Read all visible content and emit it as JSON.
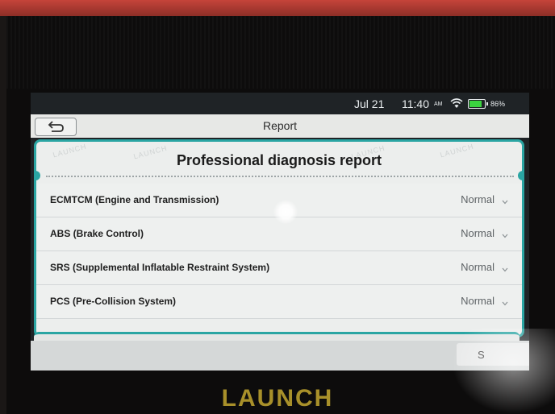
{
  "status_bar": {
    "date": "Jul 21",
    "time": "11:40",
    "ampm": "AM",
    "battery_percent": "86%",
    "battery_level": 0.86,
    "icons": [
      "wifi-icon",
      "battery-icon"
    ]
  },
  "title_bar": {
    "title": "Report",
    "back_icon": "back-arrow-icon"
  },
  "report": {
    "heading": "Professional diagnosis report",
    "watermark": "LAUNCH",
    "systems": [
      {
        "name": "ECMTCM (Engine and Transmission)",
        "status": "Normal"
      },
      {
        "name": "ABS (Brake Control)",
        "status": "Normal"
      },
      {
        "name": "SRS (Supplemental Inflatable Restraint System)",
        "status": "Normal"
      },
      {
        "name": "PCS (Pre-Collision System)",
        "status": "Normal"
      }
    ]
  },
  "toolbar": {
    "save_label": "S"
  },
  "device": {
    "brand": "LAUNCH"
  },
  "colors": {
    "accent": "#2aa5a3",
    "battery": "#3bd43f",
    "brand": "#a8902a"
  }
}
